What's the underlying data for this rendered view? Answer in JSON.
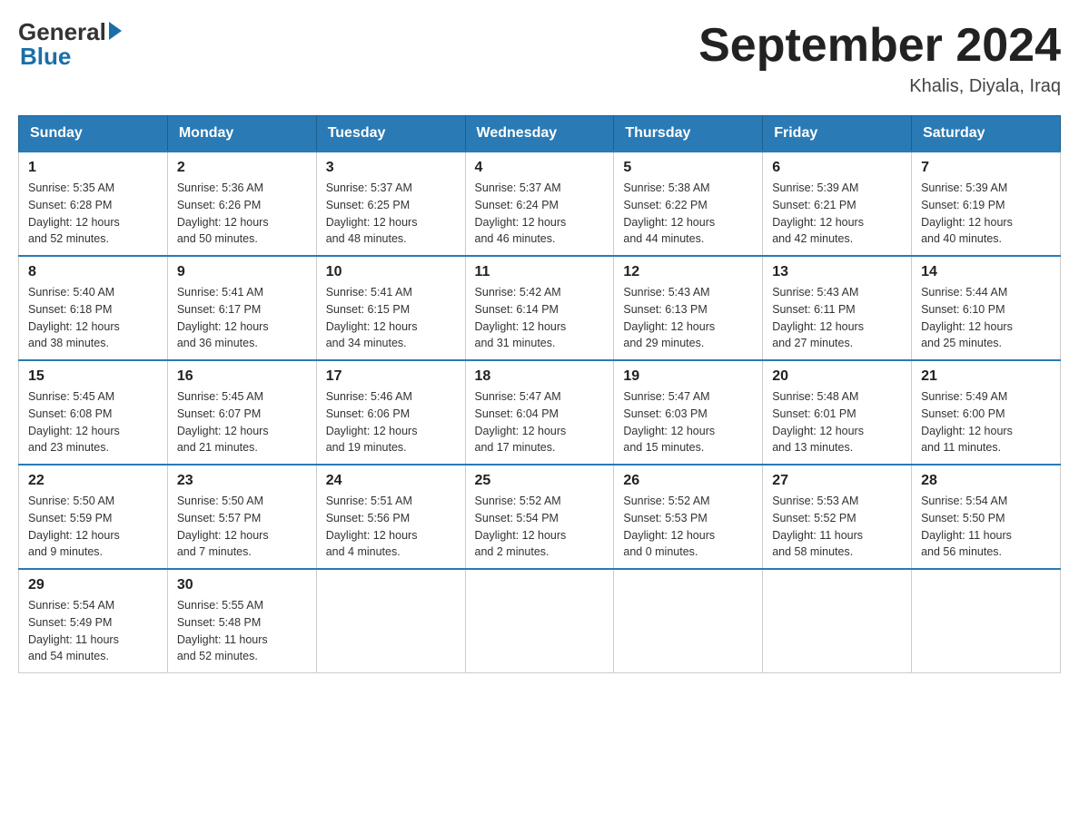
{
  "logo": {
    "general": "General",
    "blue": "Blue"
  },
  "header": {
    "title": "September 2024",
    "location": "Khalis, Diyala, Iraq"
  },
  "weekdays": [
    "Sunday",
    "Monday",
    "Tuesday",
    "Wednesday",
    "Thursday",
    "Friday",
    "Saturday"
  ],
  "weeks": [
    [
      {
        "day": "1",
        "sunrise": "5:35 AM",
        "sunset": "6:28 PM",
        "daylight": "12 hours and 52 minutes."
      },
      {
        "day": "2",
        "sunrise": "5:36 AM",
        "sunset": "6:26 PM",
        "daylight": "12 hours and 50 minutes."
      },
      {
        "day": "3",
        "sunrise": "5:37 AM",
        "sunset": "6:25 PM",
        "daylight": "12 hours and 48 minutes."
      },
      {
        "day": "4",
        "sunrise": "5:37 AM",
        "sunset": "6:24 PM",
        "daylight": "12 hours and 46 minutes."
      },
      {
        "day": "5",
        "sunrise": "5:38 AM",
        "sunset": "6:22 PM",
        "daylight": "12 hours and 44 minutes."
      },
      {
        "day": "6",
        "sunrise": "5:39 AM",
        "sunset": "6:21 PM",
        "daylight": "12 hours and 42 minutes."
      },
      {
        "day": "7",
        "sunrise": "5:39 AM",
        "sunset": "6:19 PM",
        "daylight": "12 hours and 40 minutes."
      }
    ],
    [
      {
        "day": "8",
        "sunrise": "5:40 AM",
        "sunset": "6:18 PM",
        "daylight": "12 hours and 38 minutes."
      },
      {
        "day": "9",
        "sunrise": "5:41 AM",
        "sunset": "6:17 PM",
        "daylight": "12 hours and 36 minutes."
      },
      {
        "day": "10",
        "sunrise": "5:41 AM",
        "sunset": "6:15 PM",
        "daylight": "12 hours and 34 minutes."
      },
      {
        "day": "11",
        "sunrise": "5:42 AM",
        "sunset": "6:14 PM",
        "daylight": "12 hours and 31 minutes."
      },
      {
        "day": "12",
        "sunrise": "5:43 AM",
        "sunset": "6:13 PM",
        "daylight": "12 hours and 29 minutes."
      },
      {
        "day": "13",
        "sunrise": "5:43 AM",
        "sunset": "6:11 PM",
        "daylight": "12 hours and 27 minutes."
      },
      {
        "day": "14",
        "sunrise": "5:44 AM",
        "sunset": "6:10 PM",
        "daylight": "12 hours and 25 minutes."
      }
    ],
    [
      {
        "day": "15",
        "sunrise": "5:45 AM",
        "sunset": "6:08 PM",
        "daylight": "12 hours and 23 minutes."
      },
      {
        "day": "16",
        "sunrise": "5:45 AM",
        "sunset": "6:07 PM",
        "daylight": "12 hours and 21 minutes."
      },
      {
        "day": "17",
        "sunrise": "5:46 AM",
        "sunset": "6:06 PM",
        "daylight": "12 hours and 19 minutes."
      },
      {
        "day": "18",
        "sunrise": "5:47 AM",
        "sunset": "6:04 PM",
        "daylight": "12 hours and 17 minutes."
      },
      {
        "day": "19",
        "sunrise": "5:47 AM",
        "sunset": "6:03 PM",
        "daylight": "12 hours and 15 minutes."
      },
      {
        "day": "20",
        "sunrise": "5:48 AM",
        "sunset": "6:01 PM",
        "daylight": "12 hours and 13 minutes."
      },
      {
        "day": "21",
        "sunrise": "5:49 AM",
        "sunset": "6:00 PM",
        "daylight": "12 hours and 11 minutes."
      }
    ],
    [
      {
        "day": "22",
        "sunrise": "5:50 AM",
        "sunset": "5:59 PM",
        "daylight": "12 hours and 9 minutes."
      },
      {
        "day": "23",
        "sunrise": "5:50 AM",
        "sunset": "5:57 PM",
        "daylight": "12 hours and 7 minutes."
      },
      {
        "day": "24",
        "sunrise": "5:51 AM",
        "sunset": "5:56 PM",
        "daylight": "12 hours and 4 minutes."
      },
      {
        "day": "25",
        "sunrise": "5:52 AM",
        "sunset": "5:54 PM",
        "daylight": "12 hours and 2 minutes."
      },
      {
        "day": "26",
        "sunrise": "5:52 AM",
        "sunset": "5:53 PM",
        "daylight": "12 hours and 0 minutes."
      },
      {
        "day": "27",
        "sunrise": "5:53 AM",
        "sunset": "5:52 PM",
        "daylight": "11 hours and 58 minutes."
      },
      {
        "day": "28",
        "sunrise": "5:54 AM",
        "sunset": "5:50 PM",
        "daylight": "11 hours and 56 minutes."
      }
    ],
    [
      {
        "day": "29",
        "sunrise": "5:54 AM",
        "sunset": "5:49 PM",
        "daylight": "11 hours and 54 minutes."
      },
      {
        "day": "30",
        "sunrise": "5:55 AM",
        "sunset": "5:48 PM",
        "daylight": "11 hours and 52 minutes."
      },
      null,
      null,
      null,
      null,
      null
    ]
  ],
  "labels": {
    "sunrise": "Sunrise:",
    "sunset": "Sunset:",
    "daylight": "Daylight:"
  }
}
